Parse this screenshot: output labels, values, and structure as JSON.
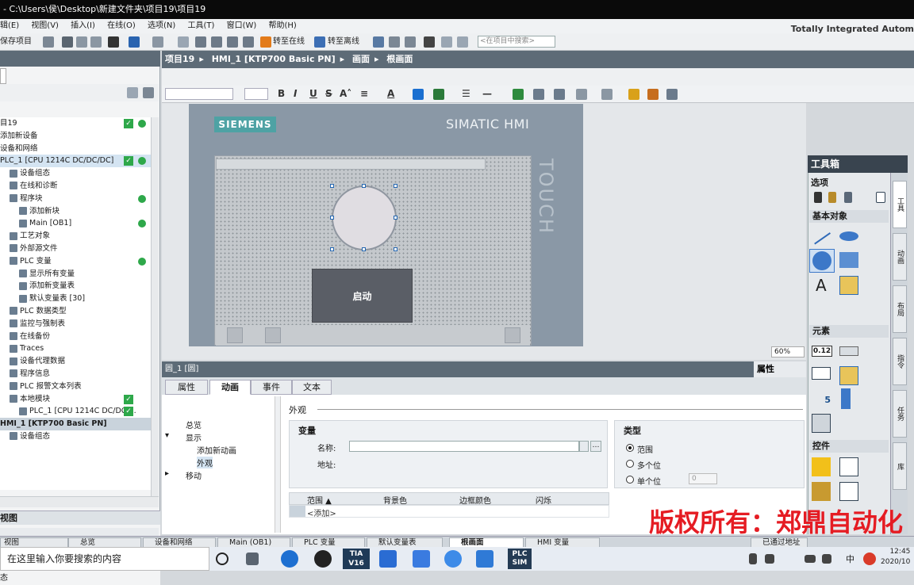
{
  "window": {
    "title": "- C:\\Users\\侯\\Desktop\\新建文件夹\\项目19\\项目19",
    "brand": "Totally Integrated Autom"
  },
  "menu": [
    "辑(E)",
    "视图(V)",
    "插入(I)",
    "在线(O)",
    "选项(N)",
    "工具(T)",
    "窗口(W)",
    "帮助(H)"
  ],
  "toolbar": {
    "save_project": "保存项目",
    "go_online": "转至在线",
    "go_offline": "转至离线",
    "search_placeholder": "<在项目中搜索>"
  },
  "breadcrumb": [
    "项目19",
    "HMI_1 [KTP700 Basic PN]",
    "画面",
    "根画面"
  ],
  "tree": {
    "items": [
      {
        "label": "目19",
        "check": true,
        "dot": true
      },
      {
        "label": "添加新设备"
      },
      {
        "label": "设备和网络"
      },
      {
        "label": "PLC_1 [CPU 1214C DC/DC/DC]",
        "check": true,
        "dot": true,
        "highlight": true
      },
      {
        "label": "设备组态",
        "indent": 1
      },
      {
        "label": "在线和诊断",
        "indent": 1
      },
      {
        "label": "程序块",
        "indent": 1,
        "dot": true
      },
      {
        "label": "添加新块",
        "indent": 2
      },
      {
        "label": "Main [OB1]",
        "indent": 2,
        "dot": true
      },
      {
        "label": "工艺对象",
        "indent": 1
      },
      {
        "label": "外部源文件",
        "indent": 1
      },
      {
        "label": "PLC 变量",
        "indent": 1,
        "dot": true
      },
      {
        "label": "显示所有变量",
        "indent": 2
      },
      {
        "label": "添加新变量表",
        "indent": 2
      },
      {
        "label": "默认变量表 [30]",
        "indent": 2
      },
      {
        "label": "PLC 数据类型",
        "indent": 1
      },
      {
        "label": "监控与强制表",
        "indent": 1
      },
      {
        "label": "在线备份",
        "indent": 1
      },
      {
        "label": "Traces",
        "indent": 1
      },
      {
        "label": "设备代理数据",
        "indent": 1
      },
      {
        "label": "程序信息",
        "indent": 1
      },
      {
        "label": "PLC 报警文本列表",
        "indent": 1
      },
      {
        "label": "本地模块",
        "indent": 1,
        "check": true
      },
      {
        "label": "PLC_1 [CPU 1214C DC/DC/...",
        "indent": 2,
        "check": true
      },
      {
        "label": "HMI_1 [KTP700 Basic PN]",
        "header": true
      },
      {
        "label": "设备组态",
        "indent": 1
      }
    ]
  },
  "detail_view": {
    "title": "视图",
    "status": "态"
  },
  "hmi": {
    "brand": "SIEMENS",
    "model": "SIMATIC HMI",
    "touch": "TOUCH",
    "button_label": "启动"
  },
  "zoom": "60%",
  "toolbox": {
    "title": "工具箱",
    "options": "选项",
    "basic_objects": "基本对象",
    "elements": "元素",
    "controls": "控件",
    "element_value": "0.12",
    "element_num": "5",
    "vtabs": [
      "工具",
      "动画",
      "布局",
      "指令",
      "任务",
      "库"
    ]
  },
  "properties": {
    "header": "圆_1 [圆]",
    "right_label": "属性",
    "tabs": [
      "属性",
      "动画",
      "事件",
      "文本"
    ],
    "active_tab": "动画",
    "nav": [
      "总览",
      "显示",
      "添加新动画",
      "外观",
      "移动"
    ],
    "section": "外观",
    "variable_title": "变量",
    "name_label": "名称:",
    "address_label": "地址:",
    "type_title": "类型",
    "type_options": [
      "范围",
      "多个位",
      "单个位"
    ],
    "single_bit_value": "0",
    "grid_headers": [
      "范围 ▲",
      "背景色",
      "边框颜色",
      "闪烁"
    ],
    "grid_add": "<添加>"
  },
  "watermark": "版权所有：郑鼎自动化",
  "bottom_tabs": [
    "视图",
    "总览",
    "设备和网络",
    "Main (OB1)",
    "PLC 变量",
    "默认变量表",
    "根画面",
    "HMI 变量",
    "已通过地址"
  ],
  "taskbar": {
    "search": "在这里输入你要搜索的内容",
    "tia": "TIA\nV16",
    "plcsim": "PLC\nSIM",
    "time": "12:45",
    "date": "2020/10",
    "ime": "中"
  }
}
